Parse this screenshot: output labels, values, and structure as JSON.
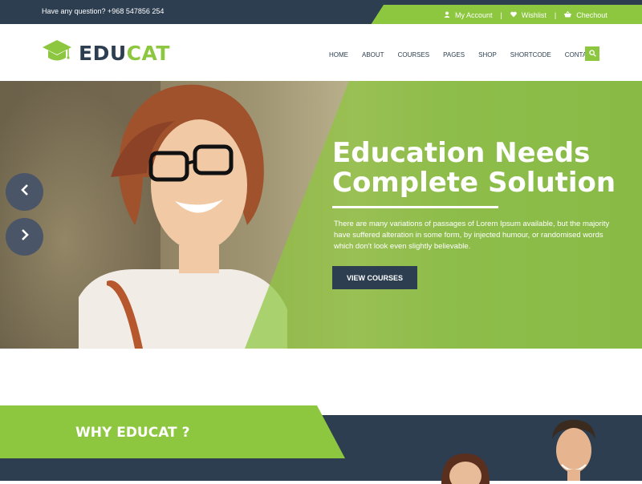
{
  "topbar": {
    "question": "Have any question? +968 547856 254",
    "links": [
      {
        "label": "My Account",
        "icon": "user-icon"
      },
      {
        "label": "Wishlist",
        "icon": "heart-icon"
      },
      {
        "label": "Chechout",
        "icon": "basket-icon"
      }
    ],
    "separator": "|"
  },
  "logo": {
    "part1": "EDU",
    "part2": "CAT",
    "icon": "graduation-cap-icon"
  },
  "nav": [
    "HOME",
    "ABOUT",
    "COURSES",
    "PAGES",
    "SHOP",
    "SHORTCODE",
    "CONTACT"
  ],
  "hero": {
    "title_line1": "Education Needs",
    "title_line2": "Complete Solution",
    "text": "There are many variations of passages of Lorem Ipsum available, but the majority have suffered alteration in some form, by injected humour, or randomised words which don't look even slightly believable.",
    "cta": "VIEW COURSES"
  },
  "why": {
    "title": "WHY EDUCAT ?"
  },
  "colors": {
    "green": "#8dc63f",
    "navy": "#2c3e50"
  }
}
